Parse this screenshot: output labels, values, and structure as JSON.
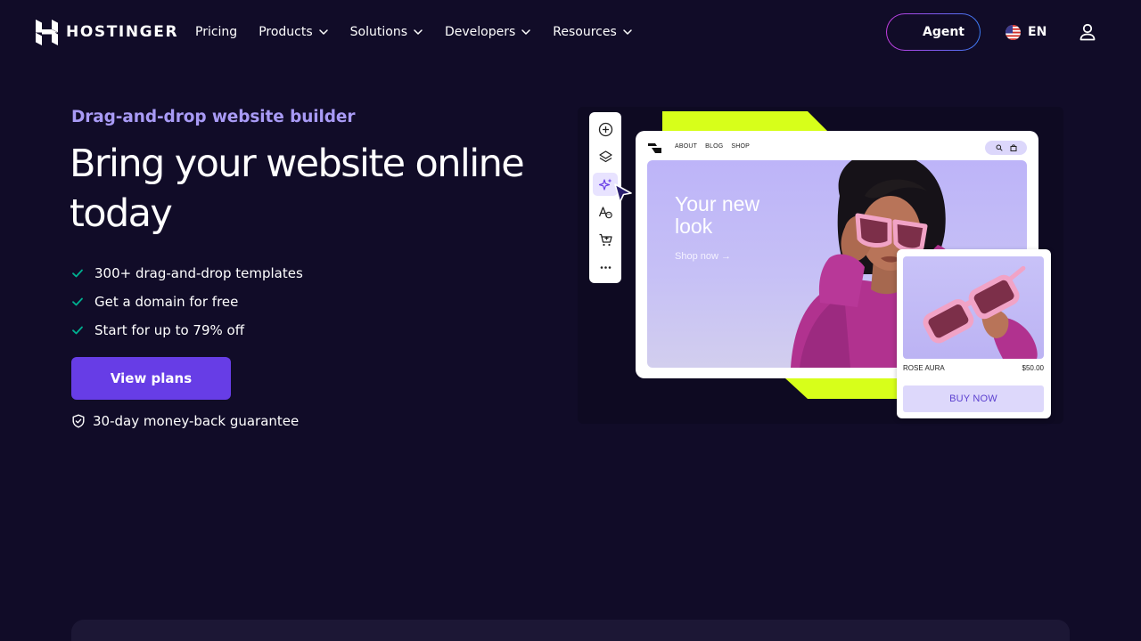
{
  "header": {
    "brand": "HOSTINGER",
    "menu": [
      {
        "label": "Pricing",
        "dropdown": false
      },
      {
        "label": "Products",
        "dropdown": true
      },
      {
        "label": "Solutions",
        "dropdown": true
      },
      {
        "label": "Developers",
        "dropdown": true
      },
      {
        "label": "Resources",
        "dropdown": true
      }
    ],
    "agent_label": "Agent",
    "language": "EN"
  },
  "hero": {
    "eyebrow": "Drag-and-drop website builder",
    "headline": "Bring your website online today",
    "features": [
      "300+ drag-and-drop templates",
      "Get a domain for free",
      "Start for up to 79% off"
    ],
    "cta_label": "View plans",
    "guarantee": "30-day money-back guarantee"
  },
  "illustration": {
    "toolbar_icons": [
      "add-icon",
      "layers-icon",
      "ai-sparkle-icon",
      "typography-icon",
      "cart-icon",
      "more-icon"
    ],
    "site_nav": [
      "ABOUT",
      "BLOG",
      "SHOP"
    ],
    "site_hero_title": "Your new look",
    "site_hero_link": "Shop now →",
    "product_name": "ROSE AURA",
    "product_price": "$50.00",
    "product_button": "BUY NOW"
  },
  "colors": {
    "background": "#110c28",
    "accent": "#673de6",
    "eyebrow": "#a89af5",
    "check": "#00b090",
    "lime": "#d7ff1a"
  }
}
